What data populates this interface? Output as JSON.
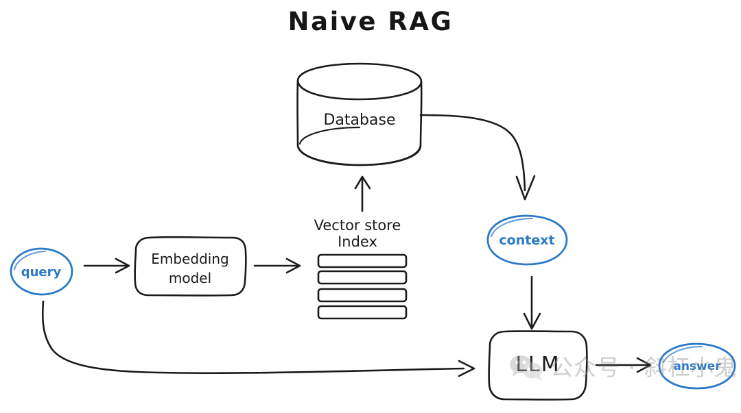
{
  "diagram": {
    "title": "Naive RAG",
    "nodes": {
      "query": {
        "label": "query",
        "shape": "ellipse",
        "color": "#2a79c9"
      },
      "embedding_model": {
        "label_line1": "Embedding",
        "label_line2": "model",
        "shape": "rounded-rectangle",
        "color": "#1b1b1b"
      },
      "vector_store": {
        "label_line1": "Vector store",
        "label_line2": "Index",
        "shape": "stacked-bars",
        "bar_count": 4,
        "color": "#1b1b1b"
      },
      "database": {
        "label": "Database",
        "shape": "cylinder",
        "color": "#1b1b1b"
      },
      "context": {
        "label": "context",
        "shape": "ellipse",
        "color": "#2a79c9"
      },
      "llm": {
        "label": "LLM",
        "shape": "rounded-rectangle",
        "color": "#1b1b1b"
      },
      "answer": {
        "label": "answer",
        "shape": "ellipse",
        "color": "#2a79c9"
      }
    },
    "edges": [
      {
        "from": "query",
        "to": "embedding_model",
        "style": "straight-arrow"
      },
      {
        "from": "embedding_model",
        "to": "vector_store",
        "style": "straight-arrow"
      },
      {
        "from": "vector_store",
        "to": "database",
        "style": "up-arrow"
      },
      {
        "from": "database",
        "to": "context",
        "style": "curved-arrow"
      },
      {
        "from": "context",
        "to": "llm",
        "style": "down-arrow"
      },
      {
        "from": "query",
        "to": "llm",
        "style": "long-curved-arrow"
      },
      {
        "from": "llm",
        "to": "answer",
        "style": "straight-arrow"
      }
    ]
  },
  "watermark": {
    "text": "公众号 · 斜杠小鬼",
    "icon": "wechat-logo",
    "color": "#8e8e8e"
  }
}
